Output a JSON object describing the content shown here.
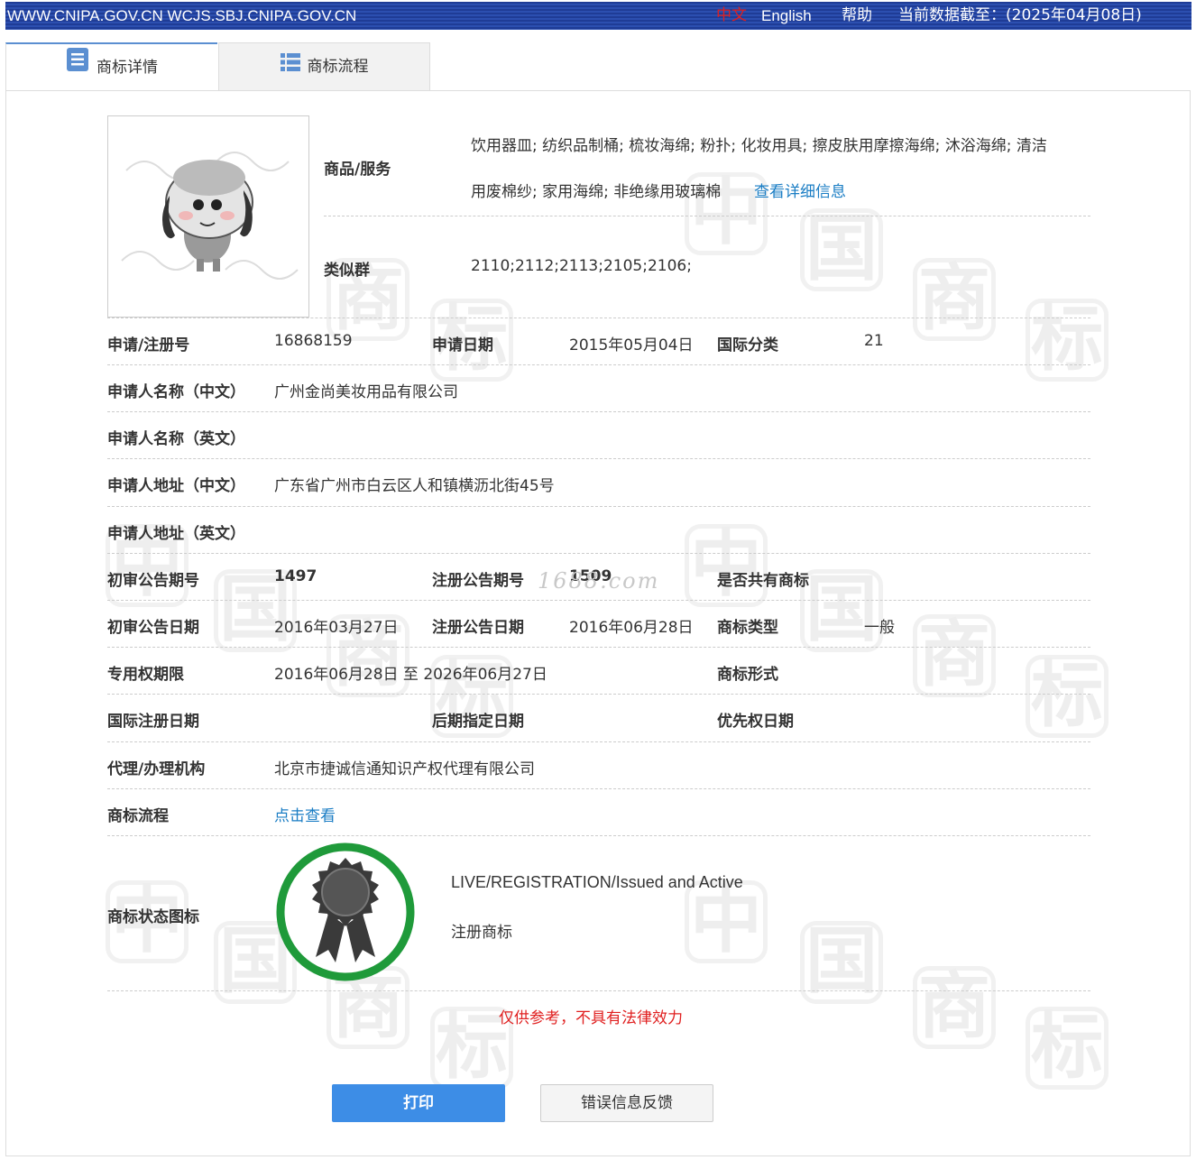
{
  "topbar": {
    "site": "WWW.CNIPA.GOV.CN WCJS.SBJ.CNIPA.GOV.CN",
    "lang_zh": "中文",
    "lang_en": "English",
    "help": "帮助",
    "data_date": "当前数据截至：(2025年04月08日)"
  },
  "tabs": [
    {
      "label": "商标详情",
      "icon": "document-list-icon"
    },
    {
      "label": "商标流程",
      "icon": "grid-list-icon"
    }
  ],
  "watermark": {
    "site": "1688.com"
  },
  "details": {
    "goods_label": "商品/服务",
    "goods_line1": "饮用器皿; 纺织品制桶; 梳妆海绵; 粉扑; 化妆用具; 擦皮肤用摩擦海绵; 沐浴海绵; 清洁",
    "goods_line2": "用废棉纱; 家用海绵; 非绝缘用玻璃棉",
    "goods_more": "查看详细信息",
    "similar_label": "类似群",
    "similar_value": "2110;2112;2113;2105;2106;",
    "reg_no_label": "申请/注册号",
    "reg_no": "16868159",
    "apply_date_label": "申请日期",
    "apply_date": "2015年05月04日",
    "intl_class_label": "国际分类",
    "intl_class": "21",
    "applicant_cn_label": "申请人名称（中文）",
    "applicant_cn": "广州金尚美妆用品有限公司",
    "applicant_en_label": "申请人名称（英文）",
    "address_cn_label": "申请人地址（中文）",
    "address_cn": "广东省广州市白云区人和镇横沥北街45号",
    "address_en_label": "申请人地址（英文）",
    "prelim_no_label": "初审公告期号",
    "prelim_no": "1497",
    "reg_pub_no_label": "注册公告期号",
    "reg_pub_no": "1509",
    "shared_label": "是否共有商标",
    "prelim_date_label": "初审公告日期",
    "prelim_date": "2016年03月27日",
    "reg_pub_date_label": "注册公告日期",
    "reg_pub_date": "2016年06月28日",
    "type_label": "商标类型",
    "type": "一般",
    "term_label": "专用权期限",
    "term": "2016年06月28日 至 2026年06月27日",
    "form_label": "商标形式",
    "intl_reg_date_label": "国际注册日期",
    "later_date_label": "后期指定日期",
    "priority_label": "优先权日期",
    "agent_label": "代理/办理机构",
    "agent": "北京市捷诚信通知识产权代理有限公司",
    "process_label": "商标流程",
    "process_link": "点击查看",
    "status_label": "商标状态图标",
    "status_en": "LIVE/REGISTRATION/Issued and Active",
    "status_cn": "注册商标"
  },
  "disclaimer": "仅供参考，不具有法律效力",
  "buttons": {
    "print": "打印",
    "feedback": "错误信息反馈"
  },
  "colors": {
    "topbar": "#1f3c96",
    "link": "#1a7dc4",
    "print_button": "#3d8de6",
    "disclaimer": "#e02020",
    "status_ring": "#1f9a3a"
  }
}
